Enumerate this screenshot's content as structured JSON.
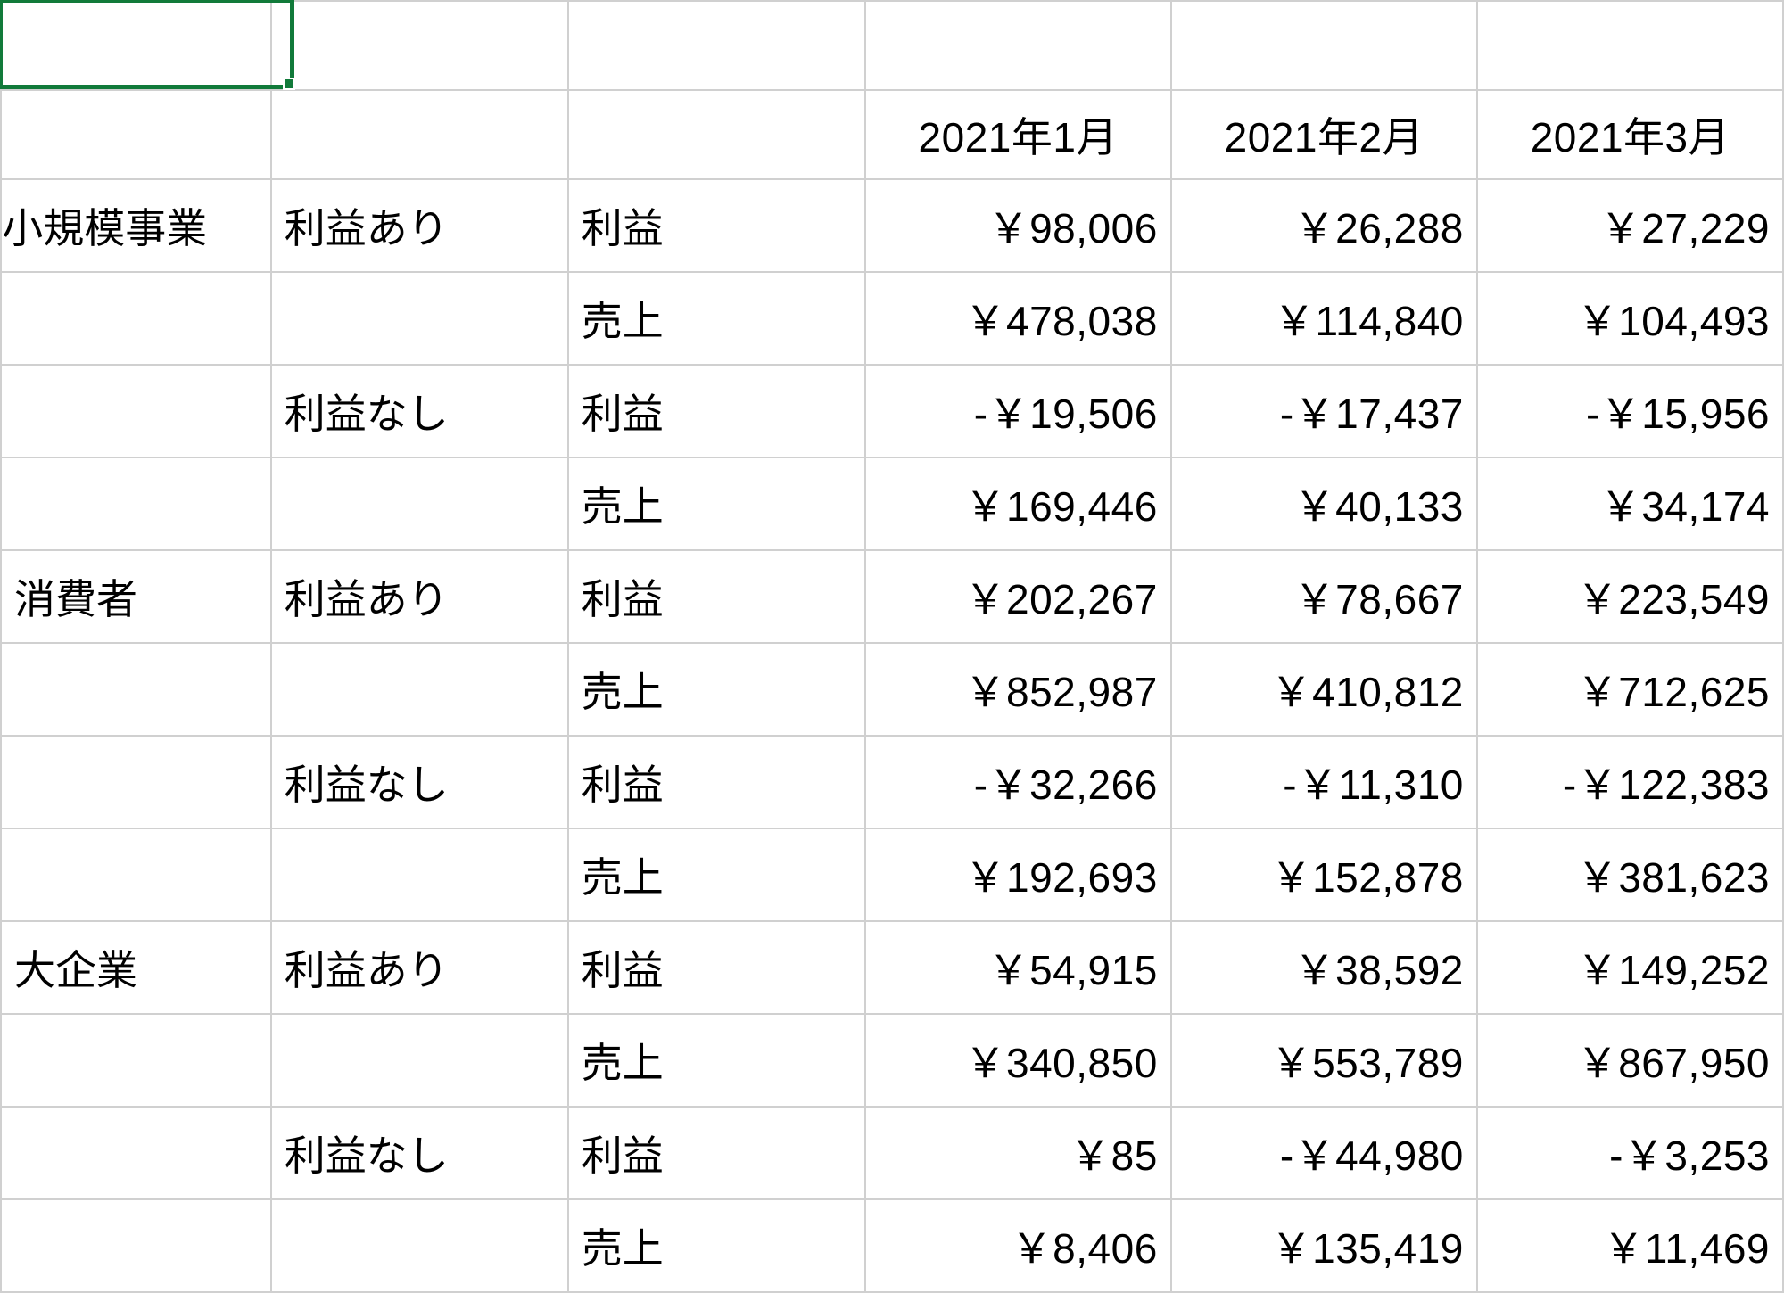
{
  "columns": [
    "2021年1月",
    "2021年2月",
    "2021年3月"
  ],
  "groups": [
    {
      "segment": "小規模事業",
      "subgroups": [
        {
          "label": "利益あり",
          "rows": [
            {
              "metric": "利益",
              "values": [
                "￥98,006",
                "￥26,288",
                "￥27,229"
              ]
            },
            {
              "metric": "売上",
              "values": [
                "￥478,038",
                "￥114,840",
                "￥104,493"
              ]
            }
          ]
        },
        {
          "label": "利益なし",
          "rows": [
            {
              "metric": "利益",
              "values": [
                "-￥19,506",
                "-￥17,437",
                "-￥15,956"
              ]
            },
            {
              "metric": "売上",
              "values": [
                "￥169,446",
                "￥40,133",
                "￥34,174"
              ]
            }
          ]
        }
      ]
    },
    {
      "segment": "消費者",
      "subgroups": [
        {
          "label": "利益あり",
          "rows": [
            {
              "metric": "利益",
              "values": [
                "￥202,267",
                "￥78,667",
                "￥223,549"
              ]
            },
            {
              "metric": "売上",
              "values": [
                "￥852,987",
                "￥410,812",
                "￥712,625"
              ]
            }
          ]
        },
        {
          "label": "利益なし",
          "rows": [
            {
              "metric": "利益",
              "values": [
                "-￥32,266",
                "-￥11,310",
                "-￥122,383"
              ]
            },
            {
              "metric": "売上",
              "values": [
                "￥192,693",
                "￥152,878",
                "￥381,623"
              ]
            }
          ]
        }
      ]
    },
    {
      "segment": "大企業",
      "subgroups": [
        {
          "label": "利益あり",
          "rows": [
            {
              "metric": "利益",
              "values": [
                "￥54,915",
                "￥38,592",
                "￥149,252"
              ]
            },
            {
              "metric": "売上",
              "values": [
                "￥340,850",
                "￥553,789",
                "￥867,950"
              ]
            }
          ]
        },
        {
          "label": "利益なし",
          "rows": [
            {
              "metric": "利益",
              "values": [
                "￥85",
                "-￥44,980",
                "-￥3,253"
              ]
            },
            {
              "metric": "売上",
              "values": [
                "￥8,406",
                "￥135,419",
                "￥11,469"
              ]
            }
          ]
        }
      ]
    }
  ]
}
